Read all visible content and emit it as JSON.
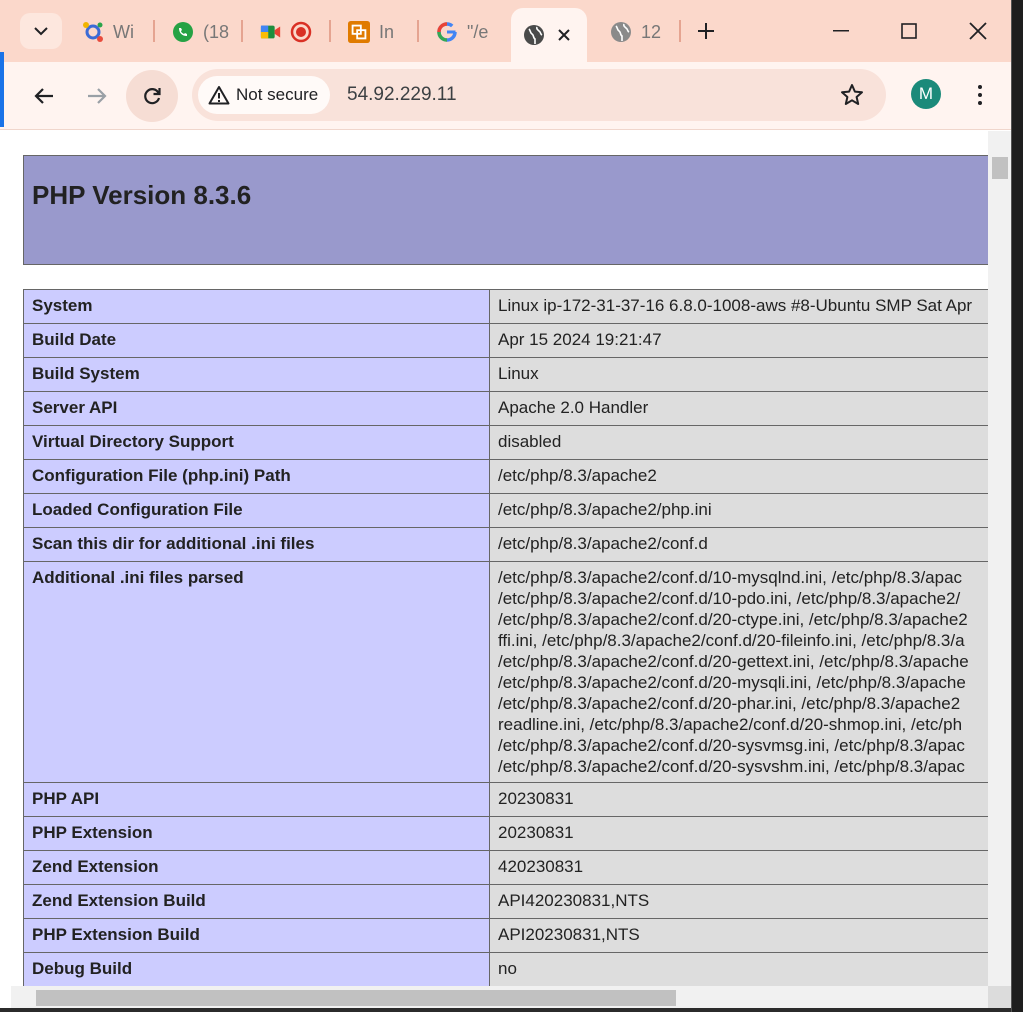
{
  "browser": {
    "tabs": [
      {
        "label": "Wi",
        "icon": "ai-app-icon"
      },
      {
        "label": "(18",
        "icon": "whatsapp-icon"
      },
      {
        "label": "",
        "icon": "google-meet-icon"
      },
      {
        "label": "In",
        "icon": "instance-icon"
      },
      {
        "label": "\"/e",
        "icon": "google-icon"
      },
      {
        "label": "",
        "icon": "globe-icon",
        "active": true
      },
      {
        "label": "12",
        "icon": "globe-icon"
      }
    ],
    "security_chip": "Not secure",
    "url": "54.92.229.11",
    "avatar_letter": "M"
  },
  "page": {
    "title": "PHP Version 8.3.6",
    "rows": [
      {
        "key": "System",
        "value": "Linux ip-172-31-37-16 6.8.0-1008-aws #8-Ubuntu SMP Sat Apr"
      },
      {
        "key": "Build Date",
        "value": "Apr 15 2024 19:21:47"
      },
      {
        "key": "Build System",
        "value": "Linux"
      },
      {
        "key": "Server API",
        "value": "Apache 2.0 Handler"
      },
      {
        "key": "Virtual Directory Support",
        "value": "disabled"
      },
      {
        "key": "Configuration File (php.ini) Path",
        "value": "/etc/php/8.3/apache2"
      },
      {
        "key": "Loaded Configuration File",
        "value": "/etc/php/8.3/apache2/php.ini"
      },
      {
        "key": "Scan this dir for additional .ini files",
        "value": "/etc/php/8.3/apache2/conf.d"
      }
    ],
    "ini_parsed_key": "Additional .ini files parsed",
    "ini_parsed_lines": [
      "/etc/php/8.3/apache2/conf.d/10-mysqlnd.ini, /etc/php/8.3/apac",
      "/etc/php/8.3/apache2/conf.d/10-pdo.ini, /etc/php/8.3/apache2/",
      "/etc/php/8.3/apache2/conf.d/20-ctype.ini, /etc/php/8.3/apache2",
      "ffi.ini, /etc/php/8.3/apache2/conf.d/20-fileinfo.ini, /etc/php/8.3/a",
      "/etc/php/8.3/apache2/conf.d/20-gettext.ini, /etc/php/8.3/apache",
      "/etc/php/8.3/apache2/conf.d/20-mysqli.ini, /etc/php/8.3/apache",
      "/etc/php/8.3/apache2/conf.d/20-phar.ini, /etc/php/8.3/apache2",
      "readline.ini, /etc/php/8.3/apache2/conf.d/20-shmop.ini, /etc/ph",
      "/etc/php/8.3/apache2/conf.d/20-sysvmsg.ini, /etc/php/8.3/apac",
      "/etc/php/8.3/apache2/conf.d/20-sysvshm.ini, /etc/php/8.3/apac"
    ],
    "rows2": [
      {
        "key": "PHP API",
        "value": "20230831"
      },
      {
        "key": "PHP Extension",
        "value": "20230831"
      },
      {
        "key": "Zend Extension",
        "value": "420230831"
      },
      {
        "key": "Zend Extension Build",
        "value": "API420230831,NTS"
      },
      {
        "key": "PHP Extension Build",
        "value": "API20230831,NTS"
      },
      {
        "key": "Debug Build",
        "value": "no"
      }
    ]
  },
  "colors": {
    "tabstrip": "#fbd8cb",
    "header": "#9999cc",
    "key_cell": "#ccccff",
    "value_cell": "#dddddd"
  }
}
